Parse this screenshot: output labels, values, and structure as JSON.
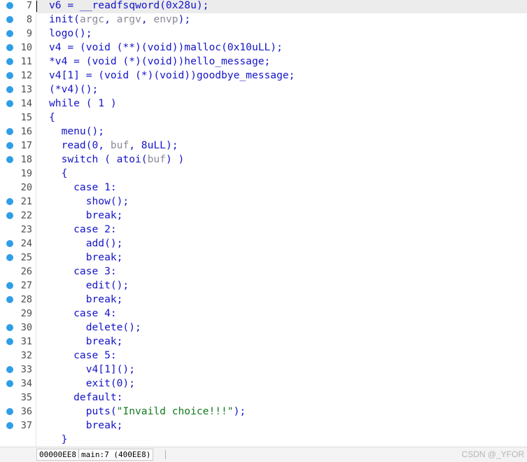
{
  "lines": [
    {
      "num": "7",
      "dot": true,
      "tokens": [
        {
          "t": "v6 = __readfsqword(0x28u);",
          "c": ""
        }
      ]
    },
    {
      "num": "8",
      "dot": true,
      "tokens": [
        {
          "t": "init(",
          "c": ""
        },
        {
          "t": "argc",
          "c": "gray"
        },
        {
          "t": ", ",
          "c": ""
        },
        {
          "t": "argv",
          "c": "gray"
        },
        {
          "t": ", ",
          "c": ""
        },
        {
          "t": "envp",
          "c": "gray"
        },
        {
          "t": ");",
          "c": ""
        }
      ]
    },
    {
      "num": "9",
      "dot": true,
      "tokens": [
        {
          "t": "logo();",
          "c": ""
        }
      ]
    },
    {
      "num": "10",
      "dot": true,
      "tokens": [
        {
          "t": "v4 = (void (**)(void))malloc(0x10uLL);",
          "c": ""
        }
      ]
    },
    {
      "num": "11",
      "dot": true,
      "tokens": [
        {
          "t": "*v4 = (void (*)(void))hello_message;",
          "c": ""
        }
      ]
    },
    {
      "num": "12",
      "dot": true,
      "tokens": [
        {
          "t": "v4[1] = (void (*)(void))goodbye_message;",
          "c": ""
        }
      ]
    },
    {
      "num": "13",
      "dot": true,
      "tokens": [
        {
          "t": "(*v4)();",
          "c": ""
        }
      ]
    },
    {
      "num": "14",
      "dot": true,
      "tokens": [
        {
          "t": "while ( 1 )",
          "c": ""
        }
      ]
    },
    {
      "num": "15",
      "dot": false,
      "tokens": [
        {
          "t": "{",
          "c": ""
        }
      ]
    },
    {
      "num": "16",
      "dot": true,
      "tokens": [
        {
          "t": "  menu();",
          "c": ""
        }
      ]
    },
    {
      "num": "17",
      "dot": true,
      "tokens": [
        {
          "t": "  read(0, ",
          "c": ""
        },
        {
          "t": "buf",
          "c": "gray"
        },
        {
          "t": ", 8uLL);",
          "c": ""
        }
      ]
    },
    {
      "num": "18",
      "dot": true,
      "tokens": [
        {
          "t": "  switch ( atoi(",
          "c": ""
        },
        {
          "t": "buf",
          "c": "gray"
        },
        {
          "t": ") )",
          "c": ""
        }
      ]
    },
    {
      "num": "19",
      "dot": false,
      "tokens": [
        {
          "t": "  {",
          "c": ""
        }
      ]
    },
    {
      "num": "20",
      "dot": false,
      "tokens": [
        {
          "t": "    case 1:",
          "c": ""
        }
      ]
    },
    {
      "num": "21",
      "dot": true,
      "tokens": [
        {
          "t": "      show();",
          "c": ""
        }
      ]
    },
    {
      "num": "22",
      "dot": true,
      "tokens": [
        {
          "t": "      break;",
          "c": ""
        }
      ]
    },
    {
      "num": "23",
      "dot": false,
      "tokens": [
        {
          "t": "    case 2:",
          "c": ""
        }
      ]
    },
    {
      "num": "24",
      "dot": true,
      "tokens": [
        {
          "t": "      add();",
          "c": ""
        }
      ]
    },
    {
      "num": "25",
      "dot": true,
      "tokens": [
        {
          "t": "      break;",
          "c": ""
        }
      ]
    },
    {
      "num": "26",
      "dot": false,
      "tokens": [
        {
          "t": "    case 3:",
          "c": ""
        }
      ]
    },
    {
      "num": "27",
      "dot": true,
      "tokens": [
        {
          "t": "      edit();",
          "c": ""
        }
      ]
    },
    {
      "num": "28",
      "dot": true,
      "tokens": [
        {
          "t": "      break;",
          "c": ""
        }
      ]
    },
    {
      "num": "29",
      "dot": false,
      "tokens": [
        {
          "t": "    case 4:",
          "c": ""
        }
      ]
    },
    {
      "num": "30",
      "dot": true,
      "tokens": [
        {
          "t": "      delete();",
          "c": ""
        }
      ]
    },
    {
      "num": "31",
      "dot": true,
      "tokens": [
        {
          "t": "      break;",
          "c": ""
        }
      ]
    },
    {
      "num": "32",
      "dot": false,
      "tokens": [
        {
          "t": "    case 5:",
          "c": ""
        }
      ]
    },
    {
      "num": "33",
      "dot": true,
      "tokens": [
        {
          "t": "      v4[1]();",
          "c": ""
        }
      ]
    },
    {
      "num": "34",
      "dot": true,
      "tokens": [
        {
          "t": "      exit(0);",
          "c": ""
        }
      ]
    },
    {
      "num": "35",
      "dot": false,
      "tokens": [
        {
          "t": "    default:",
          "c": ""
        }
      ]
    },
    {
      "num": "36",
      "dot": true,
      "tokens": [
        {
          "t": "      puts(",
          "c": ""
        },
        {
          "t": "\"Invaild choice!!!\"",
          "c": "green"
        },
        {
          "t": ");",
          "c": ""
        }
      ]
    },
    {
      "num": "37",
      "dot": true,
      "tokens": [
        {
          "t": "      break;",
          "c": ""
        }
      ]
    },
    {
      "num": "",
      "dot": false,
      "tokens": [
        {
          "t": "  }",
          "c": ""
        }
      ]
    }
  ],
  "status": {
    "address": "00000EE8",
    "location": "main:7 (400EE8)"
  },
  "watermark": "CSDN @_YFOR",
  "colors": {
    "code": "#1414c8",
    "variable": "#8a8a9a",
    "string": "#147a1e",
    "breakpoint_dot": "#2e9ee8",
    "current_line": "#ececec"
  }
}
